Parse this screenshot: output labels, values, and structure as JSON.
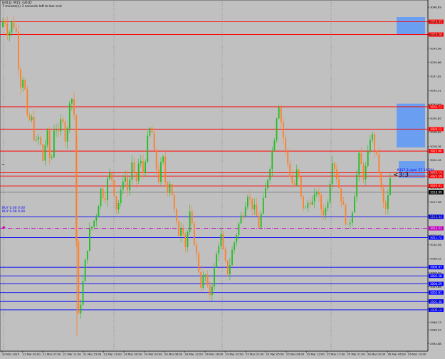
{
  "chart_header": {
    "symbol_line": "GOLD, M15: GOLD",
    "countdown_line": "7 minute(s) 3 seconds left to bar end"
  },
  "colors": {
    "background": "#c0c0c0",
    "price_line": "#4d4d4d",
    "candle_up": "#1fbf1f",
    "candle_down": "#ff7f27",
    "resistance": "#ff0000",
    "support": "#0000ff",
    "pivot": "#c000c0",
    "zone_fill": "#6a9ef0"
  },
  "overlay_labels": {
    "mid_label": "#317 3 pips( 37 10/26)",
    "alert_label": "<3:3",
    "left_label_1": "BUY 0.00 0.00",
    "left_label_2": "BUY 0.00 0.00"
  },
  "chart_data": {
    "type": "candlestick",
    "symbol": "GOLD",
    "timeframe": "M15",
    "price_axis_ticks": [
      "3048.69",
      "3046.35",
      "3044.30",
      "3042.08",
      "3039.86",
      "3037.62",
      "3035.31",
      "3033.09",
      "3030.85",
      "3028.62",
      "3026.38",
      "3024.16",
      "3021.94",
      "3019.70",
      "3017.46",
      "3015.24",
      "3014.97",
      "3012.10",
      "3010.56",
      "3008.33",
      "3006.09",
      "3003.86",
      "3001.62",
      "3000.28",
      "2998.13",
      "2996.93",
      "2994.68"
    ],
    "time_axis_ticks": [
      "20 Mar 2025",
      "21 Mar 00:00",
      "21 Mar 07:00",
      "21 Mar 11:00",
      "21 Mar 15:00",
      "21 Mar 19:00",
      "24 Mar 00:00",
      "24 Mar 04:00",
      "24 Mar 08:00",
      "24 Mar 12:00",
      "24 Mar 16:00",
      "24 Mar 20:00",
      "25 Mar 01:00",
      "25 Mar 05:00",
      "25 Mar 09:00",
      "25 Mar 13:00",
      "25 Mar 17:00",
      "25 Mar 21:00",
      "26 Mar 02:00",
      "26 Mar 06:00",
      "26 Mar 10:00"
    ],
    "resistance_levels": [
      {
        "price": 3046.35,
        "label": "3046.35"
      },
      {
        "price": 3044.3,
        "label": "3044.30"
      },
      {
        "price": 3032.71,
        "label": "3032.71"
      },
      {
        "price": 3029.12,
        "label": "3029.12"
      },
      {
        "price": 3025.6,
        "label": "3025.60"
      },
      {
        "price": 3022.14,
        "label": "3022.14"
      },
      {
        "price": 3021.59,
        "label": "3021.59"
      },
      {
        "price": 3020.01,
        "label": "3020.01"
      }
    ],
    "current_price": {
      "price": 3018.99,
      "label": "3018.99"
    },
    "support_levels": [
      {
        "price": 3015.06,
        "label": "3015.06"
      },
      {
        "price": 3011.72,
        "label": "3011.72"
      },
      {
        "price": 3006.97,
        "label": "3006.97"
      },
      {
        "price": 3005.58,
        "label": "3005.58"
      },
      {
        "price": 3004.29,
        "label": "3004.29"
      },
      {
        "price": 3002.91,
        "label": "3002.91"
      },
      {
        "price": 3001.48,
        "label": "3001.48"
      },
      {
        "price": 3000.14,
        "label": "3000.14"
      }
    ],
    "pivot_level": {
      "price": 3013.21,
      "label": "3013.21"
    },
    "zones": [
      {
        "top": 3047.1,
        "bottom": 3044.3
      },
      {
        "top": 3033.2,
        "bottom": 3026.2
      },
      {
        "top": 3024.0,
        "bottom": 3021.3
      }
    ],
    "price_path": [
      3045.5,
      3047.0,
      3044.0,
      3046.5,
      3045.0,
      3036.0,
      3038.0,
      3030.0,
      3031.0,
      3026.5,
      3028.0,
      3024.0,
      3029.0,
      3022.5,
      3030.5,
      3028.0,
      3032.0,
      3026.0,
      3035.0,
      3033.0,
      2998.0,
      3002.5,
      3008.0,
      3012.5,
      3014.0,
      3016.0,
      3019.5,
      3018.0,
      3022.0,
      3021.0,
      3016.5,
      3018.0,
      3022.5,
      3019.0,
      3023.5,
      3020.0,
      3024.5,
      3022.0,
      3027.0,
      3030.0,
      3024.0,
      3021.0,
      3025.0,
      3019.0,
      3021.0,
      3016.0,
      3012.0,
      3014.5,
      3010.0,
      3015.5,
      3012.0,
      3008.0,
      3004.0,
      3006.0,
      3002.0,
      3005.0,
      3009.0,
      3012.5,
      3008.0,
      3006.0,
      3009.5,
      3012.0,
      3014.5,
      3016.0,
      3019.0,
      3017.0,
      3016.0,
      3013.5,
      3017.0,
      3020.5,
      3024.0,
      3028.0,
      3034.0,
      3029.0,
      3025.0,
      3022.0,
      3019.5,
      3023.0,
      3017.5,
      3016.0,
      3018.0,
      3017.0,
      3019.5,
      3016.5,
      3015.5,
      3018.5,
      3024.5,
      3022.0,
      3019.0,
      3016.0,
      3013.0,
      3015.5,
      3020.0,
      3025.0,
      3021.5,
      3023.5,
      3029.0,
      3026.0,
      3023.0,
      3017.5,
      3016.0,
      3021.0
    ]
  }
}
